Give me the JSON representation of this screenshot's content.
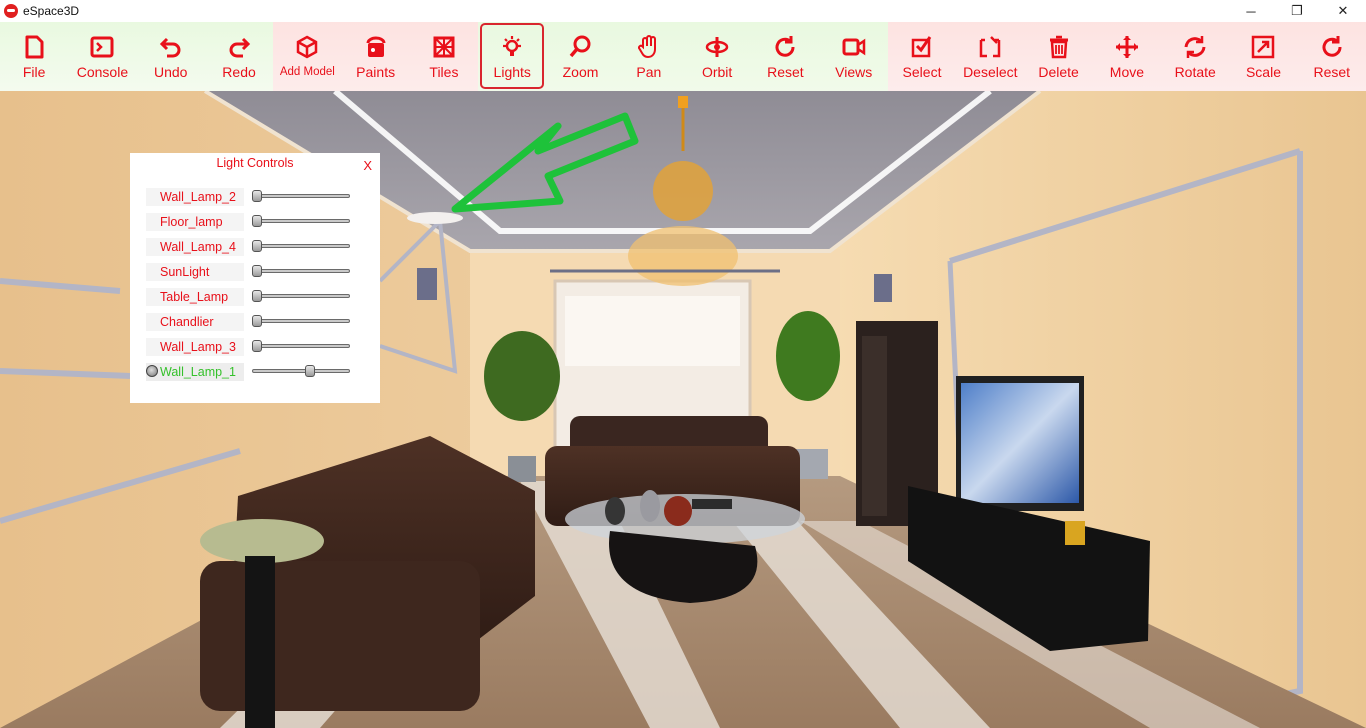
{
  "window": {
    "title": "eSpace3D",
    "minimize": "─",
    "maximize": "❐",
    "close": "✕"
  },
  "toolbar": [
    {
      "label": "File",
      "icon": "file-icon",
      "group": "g1"
    },
    {
      "label": "Console",
      "icon": "console-icon",
      "group": "g1"
    },
    {
      "label": "Undo",
      "icon": "undo-icon",
      "group": "g1"
    },
    {
      "label": "Redo",
      "icon": "redo-icon",
      "group": "g1"
    },
    {
      "label": "Add Model",
      "icon": "cube-icon",
      "group": "g2"
    },
    {
      "label": "Paints",
      "icon": "paint-bucket-icon",
      "group": "g2"
    },
    {
      "label": "Tiles",
      "icon": "tiles-icon",
      "group": "g2"
    },
    {
      "label": "Lights",
      "icon": "lightbulb-icon",
      "group": "g3",
      "active": true
    },
    {
      "label": "Zoom",
      "icon": "zoom-icon",
      "group": "g3"
    },
    {
      "label": "Pan",
      "icon": "hand-icon",
      "group": "g3"
    },
    {
      "label": "Orbit",
      "icon": "orbit-icon",
      "group": "g3"
    },
    {
      "label": "Reset",
      "icon": "reset-icon",
      "group": "g3"
    },
    {
      "label": "Views",
      "icon": "camera-icon",
      "group": "g3"
    },
    {
      "label": "Select",
      "icon": "select-icon",
      "group": "g4"
    },
    {
      "label": "Deselect",
      "icon": "deselect-icon",
      "group": "g4"
    },
    {
      "label": "Delete",
      "icon": "trash-icon",
      "group": "g4"
    },
    {
      "label": "Move",
      "icon": "move-icon",
      "group": "g4"
    },
    {
      "label": "Rotate",
      "icon": "rotate-icon",
      "group": "g4"
    },
    {
      "label": "Scale",
      "icon": "scale-icon",
      "group": "g4"
    },
    {
      "label": "Reset",
      "icon": "reset-icon",
      "group": "g4"
    }
  ],
  "light_panel": {
    "title": "Light Controls",
    "close_label": "X",
    "lights": [
      {
        "name": "Wall_Lamp_2",
        "level": 0.0
      },
      {
        "name": "Floor_lamp",
        "level": 0.0
      },
      {
        "name": "Wall_Lamp_4",
        "level": 0.0
      },
      {
        "name": "SunLight",
        "level": 0.0
      },
      {
        "name": "Table_Lamp",
        "level": 0.0
      },
      {
        "name": "Chandlier",
        "level": 0.0
      },
      {
        "name": "Wall_Lamp_3",
        "level": 0.0
      },
      {
        "name": "Wall_Lamp_1",
        "level": 0.62,
        "active": true
      }
    ]
  },
  "colors": {
    "accent": "#e8101a",
    "active_light": "#35c12b",
    "arrow": "#1ec23a"
  }
}
